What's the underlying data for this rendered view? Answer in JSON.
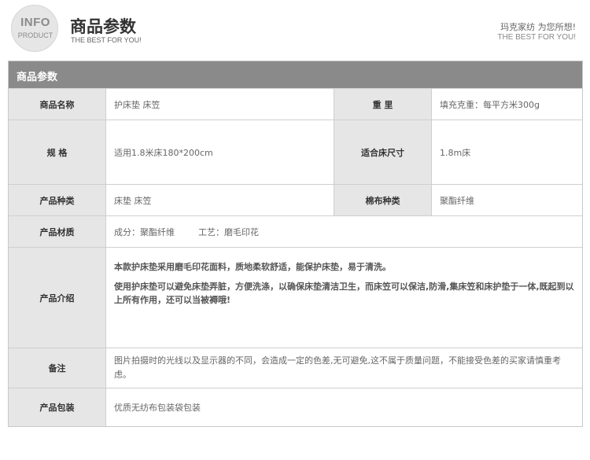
{
  "header": {
    "logo_line1": "INFO",
    "logo_line2": "PRODUCT",
    "title": "商品参数",
    "subtitle": "THE BEST FOR YOU!",
    "right_line1": "玛克家纺 为您所想!",
    "right_line2": "THE BEST FOR YOU!"
  },
  "table": {
    "section_title": "商品参数",
    "name_label": "商品名称",
    "name_value": "护床垫 床笠",
    "weight_label": "重 里",
    "weight_value": "填充克重：每平方米300g",
    "spec_label": "规 格",
    "spec_value": "适用1.8米床180*200cm",
    "bed_size_label": "适合床尺寸",
    "bed_size_value": "1.8m床",
    "type_label": "产品种类",
    "type_value": "床垫 床笠",
    "fabric_label": "棉布种类",
    "fabric_value": "聚酯纤维",
    "material_label": "产品材质",
    "material_value": "成分：聚酯纤维",
    "craft_value": "工艺：磨毛印花",
    "intro_label": "产品介绍",
    "intro_p1": "本款护床垫采用磨毛印花面料，质地柔软舒适，能保护床垫，易于清洗。",
    "intro_p2": "使用护床垫可以避免床垫弄脏，方便洗涤，以确保床垫清洁卫生，而床笠可以保洁,防滑,集床笠和床护垫于一体,既起到以上所有作用，还可以当被褥哦!",
    "remark_label": "备注",
    "remark_value": "图片拍摄时的光线以及显示器的不同，会造成一定的色差,无可避免,这不属于质量问题，不能接受色差的买家请慎重考虑。",
    "package_label": "产品包装",
    "package_value": "优质无纺布包装袋包装"
  },
  "colors": {
    "bar": "#8a8a8a",
    "label_bg": "#e6e6e6",
    "border": "#cfcfcf"
  }
}
